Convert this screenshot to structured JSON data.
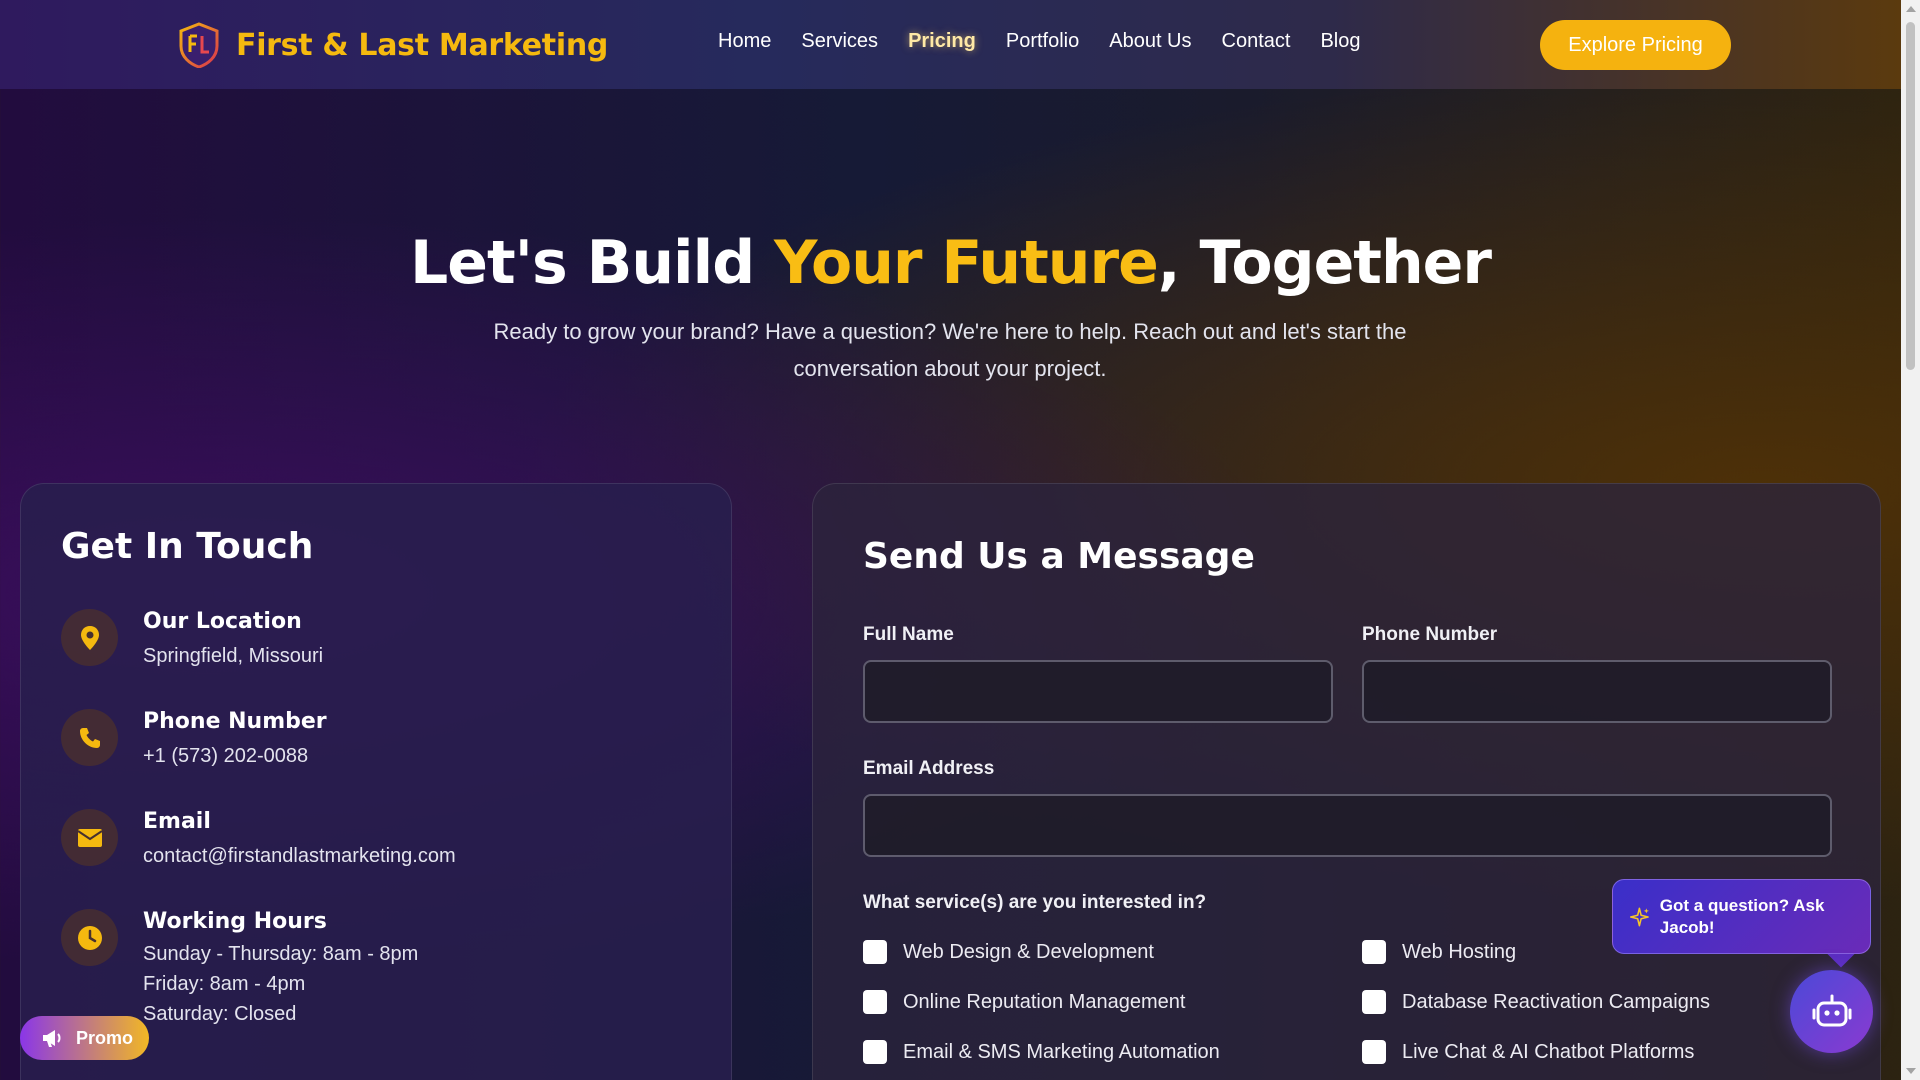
{
  "nav": {
    "brand": "First & Last Marketing",
    "links": [
      {
        "label": "Home"
      },
      {
        "label": "Services"
      },
      {
        "label": "Pricing"
      },
      {
        "label": "Portfolio"
      },
      {
        "label": "About Us"
      },
      {
        "label": "Contact"
      },
      {
        "label": "Blog"
      }
    ],
    "active_link": "Pricing",
    "cta_label": "Explore Pricing"
  },
  "hero": {
    "title_part1": "Let's Build ",
    "title_accent": "Your Future",
    "title_part2": ", Together",
    "subtitle": "Ready to grow your brand? Have a question? We're here to help. Reach out and let's start the conversation about your project."
  },
  "contact_info": {
    "title": "Get In Touch",
    "items": [
      {
        "label": "Our Location",
        "icon": "map-pin-icon",
        "lines": [
          "Springfield, Missouri"
        ]
      },
      {
        "label": "Phone Number",
        "icon": "phone-icon",
        "lines": [
          "+1 (573) 202-0088"
        ]
      },
      {
        "label": "Email",
        "icon": "envelope-icon",
        "lines": [
          "contact@firstandlastmarketing.com"
        ]
      },
      {
        "label": "Working Hours",
        "icon": "clock-icon",
        "lines": [
          "Sunday - Thursday: 8am - 8pm",
          "Friday: 8am - 4pm",
          "Saturday: Closed"
        ]
      }
    ]
  },
  "form": {
    "title": "Send Us a Message",
    "full_name_label": "Full Name",
    "full_name_value": "",
    "phone_label": "Phone Number",
    "phone_value": "",
    "email_label": "Email Address",
    "email_value": "",
    "services_question": "What service(s) are you interested in?",
    "services": [
      {
        "label": "Web Design & Development",
        "checked": false
      },
      {
        "label": "Web Hosting",
        "checked": false
      },
      {
        "label": "Online Reputation Management",
        "checked": false
      },
      {
        "label": "Database Reactivation Campaigns",
        "checked": false
      },
      {
        "label": "Email & SMS Marketing Automation",
        "checked": false
      },
      {
        "label": "Live Chat & AI Chatbot Platforms",
        "checked": false
      }
    ]
  },
  "widgets": {
    "promo_label": "Promo",
    "chat_prompt": "Got a question? Ask Jacob!"
  },
  "colors": {
    "accent": "#f5b90f",
    "cta_bg": "#f5b20f",
    "chat_gradient_start": "#3a2fc9",
    "chat_gradient_end": "#6a2bb8",
    "promo_gradient_start": "#8a36e8",
    "promo_gradient_end": "#f2b824"
  }
}
